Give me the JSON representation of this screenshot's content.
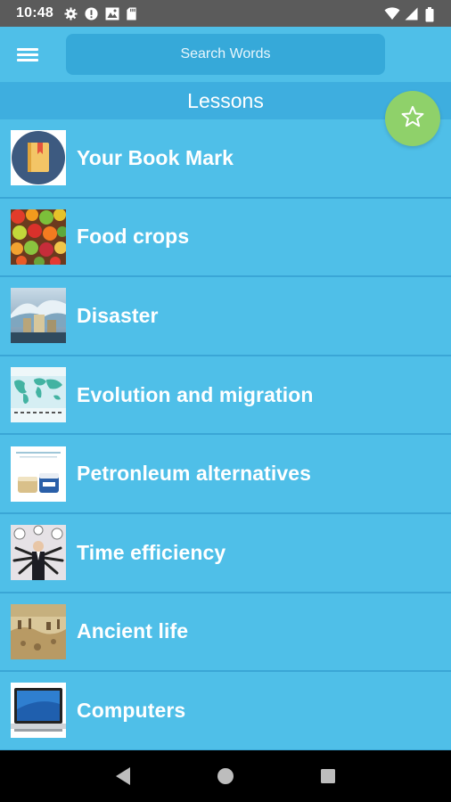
{
  "status_bar": {
    "time": "10:48",
    "icons_left": [
      "gear-icon",
      "alert-icon",
      "image-icon",
      "sd-card-icon"
    ],
    "icons_right": [
      "wifi-icon",
      "signal-icon",
      "battery-icon"
    ]
  },
  "app_bar": {
    "menu_icon": "hamburger-menu-icon",
    "search_placeholder": "Search Words"
  },
  "section_title": "Lessons",
  "fab": {
    "icon": "star-outline-icon",
    "color": "#8fd16a"
  },
  "lessons": [
    {
      "label": "Your Book Mark",
      "thumb": "bookmark-book"
    },
    {
      "label": "Food crops",
      "thumb": "fruits-vegetables"
    },
    {
      "label": "Disaster",
      "thumb": "tsunami-city"
    },
    {
      "label": "Evolution and migration",
      "thumb": "world-map"
    },
    {
      "label": "Petronleum alternatives",
      "thumb": "petroleum-jelly-jars"
    },
    {
      "label": "Time efficiency",
      "thumb": "businessman-clocks"
    },
    {
      "label": "Ancient life",
      "thumb": "ancient-painting"
    },
    {
      "label": "Computers",
      "thumb": "laptop"
    }
  ],
  "nav_bar": [
    "back-icon",
    "home-icon",
    "recents-icon"
  ],
  "colors": {
    "background": "#4fbfe8",
    "header": "#3eaedf",
    "search_field": "#36a9d9",
    "status_bar": "#5b5b5b"
  }
}
